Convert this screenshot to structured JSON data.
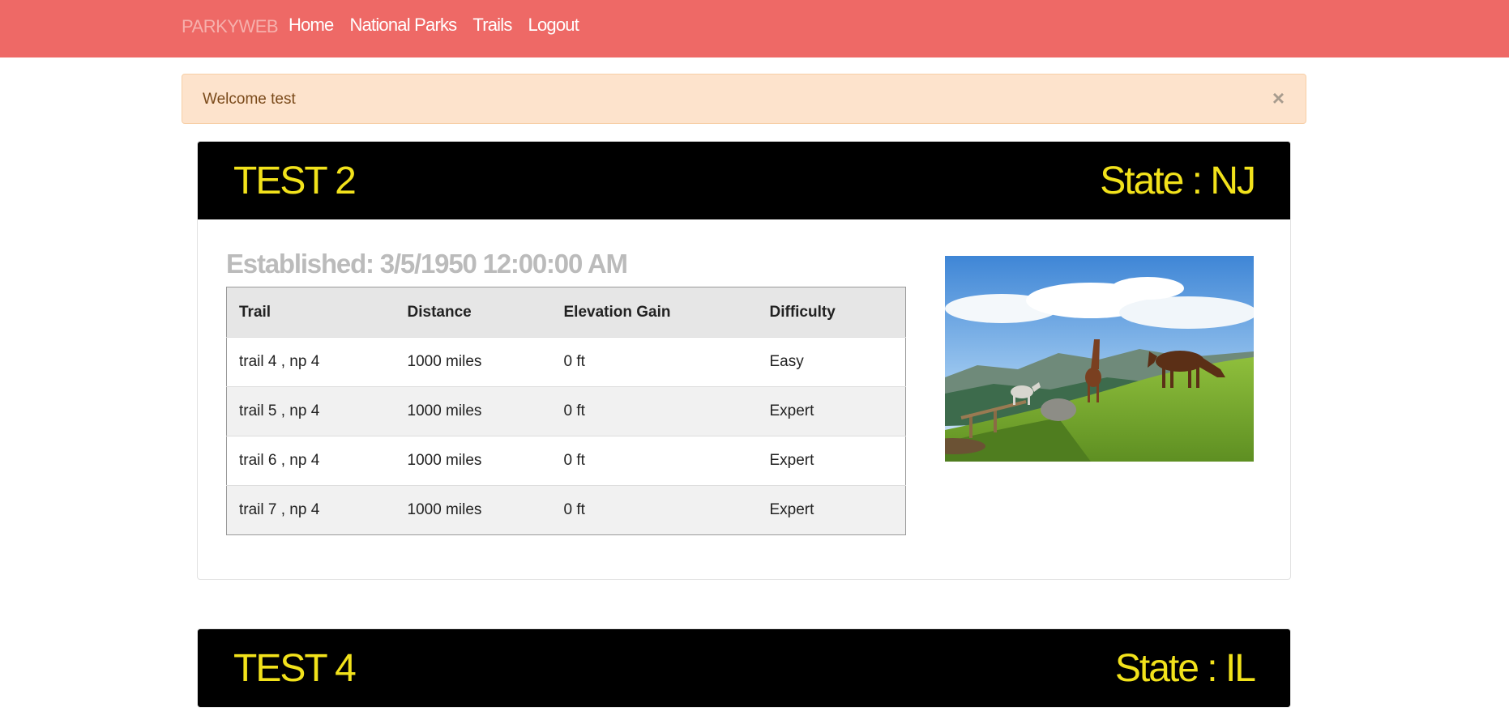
{
  "nav": {
    "brand": "PARKYWEB",
    "links": [
      "Home",
      "National Parks",
      "Trails",
      "Logout"
    ]
  },
  "alert": {
    "message": "Welcome test",
    "close_glyph": "×"
  },
  "parks": [
    {
      "name": "TEST 2",
      "state": "State : NJ",
      "established": "Established: 3/5/1950 12:00:00 AM",
      "table": {
        "headers": [
          "Trail",
          "Distance",
          "Elevation Gain",
          "Difficulty"
        ],
        "rows": [
          [
            "trail 4 , np 4",
            "1000 miles",
            "0 ft",
            "Easy"
          ],
          [
            "trail 5 , np 4",
            "1000 miles",
            "0 ft",
            "Expert"
          ],
          [
            "trail 6 , np 4",
            "1000 miles",
            "0 ft",
            "Expert"
          ],
          [
            "trail 7 , np 4",
            "1000 miles",
            "0 ft",
            "Expert"
          ]
        ]
      },
      "image_icon": "horses-landscape-photo"
    },
    {
      "name": "TEST 4",
      "state": "State : IL"
    }
  ],
  "colors": {
    "navbar": "#ee6966",
    "brand": "#f6b0ac",
    "alert_bg": "#fde3cc",
    "header_bg": "#000000",
    "header_text": "#f2e21b",
    "established": "#bbbbbb"
  }
}
